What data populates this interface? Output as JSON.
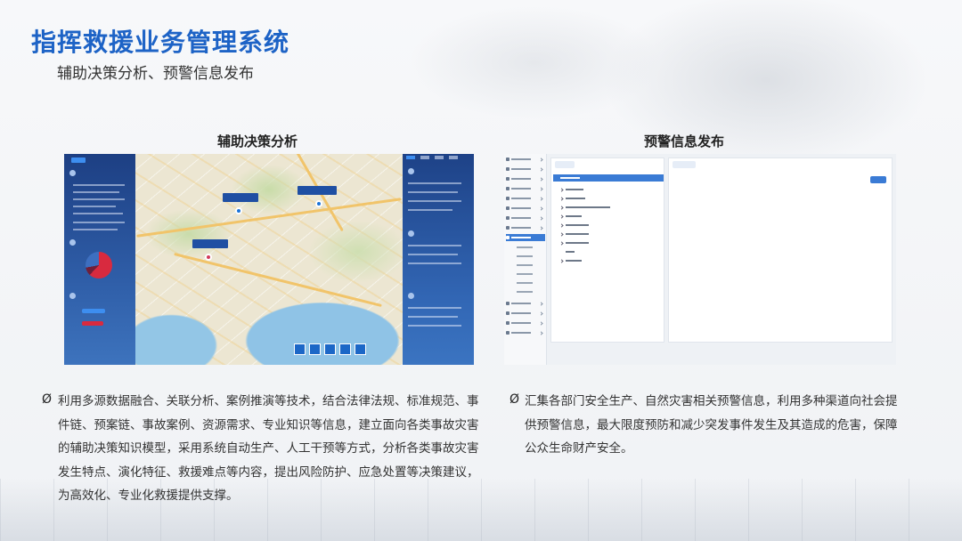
{
  "header": {
    "title": "指挥救援业务管理系统",
    "subtitle": "辅助决策分析、预警信息发布"
  },
  "panels": [
    {
      "title": "辅助决策分析",
      "bullet_mark": "Ø",
      "text": "利用多源数据融合、关联分析、案例推演等技术，结合法律法规、标准规范、事件链、预案链、事故案例、资源需求、专业知识等信息，建立面向各类事故灾害的辅助决策知识模型，采用系统自动生产、人工干预等方式，分析各类事故灾害发生特点、演化特征、救援难点等内容，提出风险防护、应急处置等决策建议，为高效化、专业化救援提供支撑。"
    },
    {
      "title": "预警信息发布",
      "bullet_mark": "Ø",
      "text": "汇集各部门安全生产、自然灾害相关预警信息，利用多种渠道向社会提供预警信息，最大限度预防和减少突发事件发生及其造成的危害，保障公众生命财产安全。"
    }
  ],
  "colors": {
    "title_blue": "#1d63c6",
    "panel_navy": "#1d3f83",
    "accent_blue": "#3a7bd5",
    "alert_red": "#d82a3f"
  }
}
